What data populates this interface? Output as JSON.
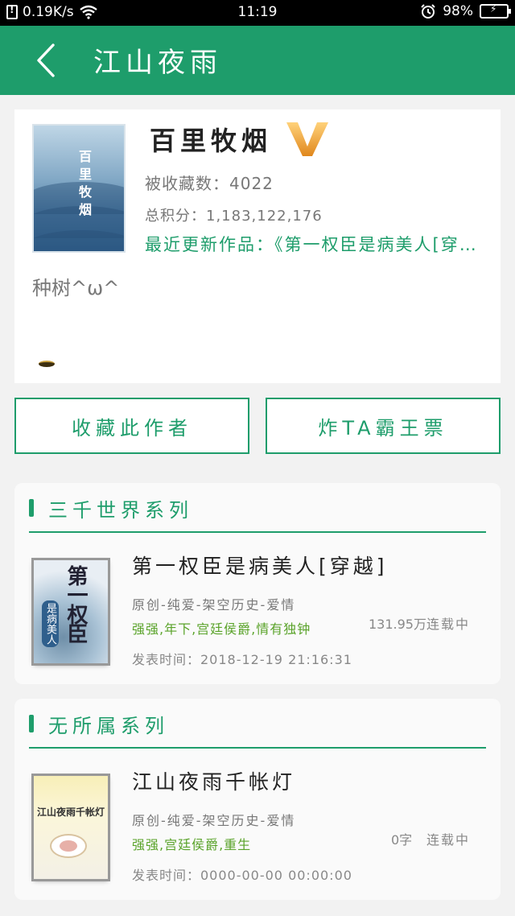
{
  "status_bar": {
    "network_speed": "0.19K/s",
    "time": "11:19",
    "battery_percent": "98%",
    "battery_level": 0.98
  },
  "header": {
    "title": "江山夜雨",
    "back_icon": "chevron-left-icon"
  },
  "profile": {
    "author_name": "百里牧烟",
    "vip_icon": "vip-v-badge-icon",
    "cover_text": "百里牧烟",
    "favorites": "被收藏数：4022",
    "total_points": "总积分：1,183,122,176",
    "recent_work": "最近更新作品：《第一权臣是病美人[穿越]》",
    "signature": "种树^ω^"
  },
  "actions": {
    "favorite_label": "收藏此作者",
    "ticket_label": "炸TA霸王票"
  },
  "series": [
    {
      "title": "三千世界系列",
      "book": {
        "title": "第一权臣是病美人[穿越]",
        "meta": "原创-纯爱-架空历史-爱情",
        "tags": "强强,年下,宫廷侯爵,情有独钟",
        "publish_time": "发表时间：2018-12-19 21:16:31",
        "word_count": "131.95万",
        "status": "连载中",
        "cover_text": "第一权臣",
        "cover_subtitle": "是病美人"
      }
    },
    {
      "title": "无所属系列",
      "book": {
        "title": "江山夜雨千帐灯",
        "meta": "原创-纯爱-架空历史-爱情",
        "tags": "强强,宫廷侯爵,重生",
        "publish_time": "发表时间：0000-00-00 00:00:00",
        "word_count": "0字",
        "status": "连载中",
        "cover_text": "江山夜雨千帐灯"
      }
    }
  ],
  "colors": {
    "accent": "#1e9d6b",
    "tag_green": "#5aa32a"
  }
}
